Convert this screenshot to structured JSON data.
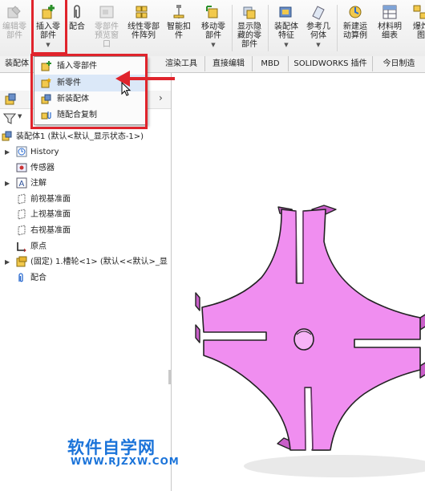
{
  "ribbon": {
    "buttons": [
      {
        "label": "编辑零\n部件",
        "disabled": true
      },
      {
        "label": "插入零\n部件",
        "disabled": false
      },
      {
        "label": "配合",
        "disabled": false
      },
      {
        "label": "零部件\n预览窗\n口",
        "disabled": true
      },
      {
        "label": "线性零部\n件阵列",
        "disabled": false
      },
      {
        "label": "智能扣\n件",
        "disabled": false
      },
      {
        "label": "移动零\n部件",
        "disabled": false
      },
      {
        "label": "显示隐\n藏的零\n部件",
        "disabled": false
      },
      {
        "label": "装配体\n特征",
        "disabled": false
      },
      {
        "label": "参考几\n何体",
        "disabled": false
      },
      {
        "label": "新建运\n动算例",
        "disabled": false
      },
      {
        "label": "材料明\n细表",
        "disabled": false
      },
      {
        "label": "爆炸\n图",
        "disabled": false
      }
    ]
  },
  "tabs": [
    "装配体",
    "渲染工具",
    "直接编辑",
    "MBD",
    "SOLIDWORKS 插件",
    "今日制造"
  ],
  "dropdown": {
    "items": [
      {
        "label": "插入零部件"
      },
      {
        "label": "新零件"
      },
      {
        "label": "新装配体"
      },
      {
        "label": "随配合复制"
      }
    ]
  },
  "tree": {
    "root": "装配体1  (默认<默认_显示状态-1>)",
    "items": [
      {
        "label": "History"
      },
      {
        "label": "传感器"
      },
      {
        "label": "注解"
      },
      {
        "label": "前视基准面"
      },
      {
        "label": "上视基准面"
      },
      {
        "label": "右视基准面"
      },
      {
        "label": "原点"
      },
      {
        "label": "(固定) 1.槽轮<1> (默认<<默认>_显"
      },
      {
        "label": "配合"
      }
    ]
  },
  "watermark": {
    "title": "软件自学网",
    "url": "WWW.RJZXW.COM"
  },
  "colors": {
    "part_fill": "#f08ef0",
    "part_shade": "#c95fc9",
    "annotation_red": "#e0242c",
    "watermark_blue": "#1a73d9",
    "highlight": "#dbe8f8"
  }
}
